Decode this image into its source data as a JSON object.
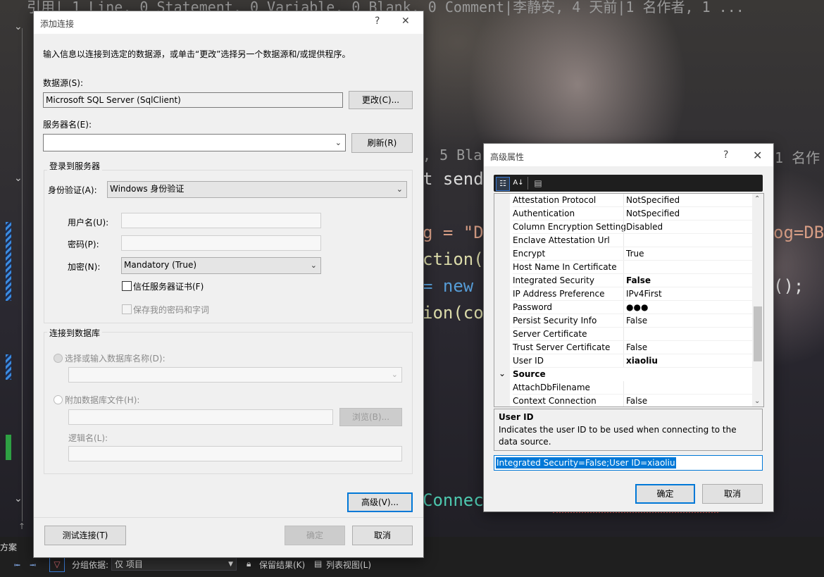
{
  "background": {
    "codelens_top": "引用|  1 Line, 0 Statement, 0 Variable, 0 Blank, 0 Comment|李静安, 4 天前|1 名作者, 1 ...",
    "codelens_mid": ", 5 Bla",
    "codelens_mid_right": "1 名作",
    "code_send": "t send",
    "code_str": "g = \"D",
    "code_str_right": "og=DB",
    "code_ction": "ction(",
    "code_new": "= new s",
    "code_new_right": "();",
    "code_ion": "ion(co",
    "code_connect": "Connect",
    "solution_label": "方案",
    "toolbar": {
      "group_by": "分组依据:",
      "group_value": "仅 项目",
      "keep_results": "保留结果(K)",
      "list_view": "列表视图(L)"
    }
  },
  "add_connection": {
    "title": "添加连接",
    "help": "?",
    "close": "✕",
    "instruction": "输入信息以连接到选定的数据源，或单击“更改”选择另一个数据源和/或提供程序。",
    "datasource_label": "数据源(S):",
    "datasource_value": "Microsoft SQL Server (SqlClient)",
    "change_button": "更改(C)...",
    "server_label": "服务器名(E):",
    "server_value": "",
    "refresh_button": "刷新(R)",
    "login_group": "登录到服务器",
    "auth_label": "身份验证(A):",
    "auth_value": "Windows 身份验证",
    "username_label": "用户名(U):",
    "password_label": "密码(P):",
    "encrypt_label": "加密(N):",
    "encrypt_value": "Mandatory (True)",
    "trust_cert": "信任服务器证书(F)",
    "save_password": "保存我的密码和字词",
    "db_group": "连接到数据库",
    "select_db": "选择或输入数据库名称(D):",
    "attach_db": "附加数据库文件(H):",
    "browse_button": "浏览(B)...",
    "logical_name": "逻辑名(L):",
    "advanced_button": "高级(V)...",
    "test_button": "测试连接(T)",
    "ok_button": "确定",
    "cancel_button": "取消"
  },
  "advanced": {
    "title": "高级属性",
    "help": "?",
    "close": "✕",
    "properties": [
      {
        "name": "Attestation Protocol",
        "value": "NotSpecified",
        "bold": false
      },
      {
        "name": "Authentication",
        "value": "NotSpecified",
        "bold": false
      },
      {
        "name": "Column Encryption Setting",
        "value": "Disabled",
        "bold": false
      },
      {
        "name": "Enclave Attestation Url",
        "value": "",
        "bold": false
      },
      {
        "name": "Encrypt",
        "value": "True",
        "bold": false
      },
      {
        "name": "Host Name In Certificate",
        "value": "",
        "bold": false
      },
      {
        "name": "Integrated Security",
        "value": "False",
        "bold": true
      },
      {
        "name": "IP Address Preference",
        "value": "IPv4First",
        "bold": false
      },
      {
        "name": "Password",
        "value": "●●●",
        "bold": false
      },
      {
        "name": "Persist Security Info",
        "value": "False",
        "bold": false
      },
      {
        "name": "Server Certificate",
        "value": "",
        "bold": false
      },
      {
        "name": "Trust Server Certificate",
        "value": "False",
        "bold": false
      },
      {
        "name": "User ID",
        "value": "xiaoliu",
        "bold": true
      },
      {
        "name": "Source",
        "value": "",
        "category": true
      },
      {
        "name": "AttachDbFilename",
        "value": "",
        "bold": false
      },
      {
        "name": "Context Connection",
        "value": "False",
        "bold": false
      }
    ],
    "desc_title": "User ID",
    "desc_text": "Indicates the user ID to be used when connecting to the data source.",
    "connection_string": "Integrated Security=False;User ID=xiaoliu",
    "ok_button": "确定",
    "cancel_button": "取消"
  }
}
